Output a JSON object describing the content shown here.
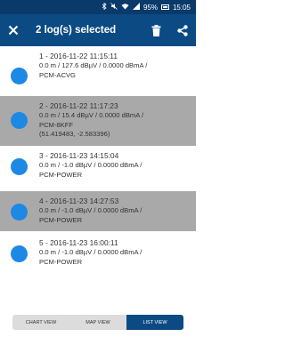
{
  "status_bar": {
    "bluetooth_icon": "bluetooth-icon",
    "mute_icon": "mute-icon",
    "wifi_icon": "wifi-icon",
    "signal_icon": "signal-icon",
    "battery_percent": "95%",
    "time": "15:05"
  },
  "app_bar": {
    "title": "2 log(s) selected",
    "close_icon": "close-icon",
    "delete_icon": "trash-icon",
    "share_icon": "share-icon"
  },
  "logs": [
    {
      "heading": "1 - 2016-11-22 11:15:11",
      "lines": [
        "0.0 m / 127.6 dBµV / 0.0000 dBmA /",
        "PCM-ACVG"
      ],
      "selected": false
    },
    {
      "heading": "2 - 2016-11-22 11:17:23",
      "lines": [
        "0.0 m / 15.4 dBµV / 0.0000 dBmA /",
        "PCM-8KFF",
        "(51.419483, -2.583396)"
      ],
      "selected": true
    },
    {
      "heading": "3 - 2016-11-23 14:15:04",
      "lines": [
        "0.0 m / -1.0 dBµV / 0.0000 dBmA /",
        "PCM-POWER"
      ],
      "selected": false
    },
    {
      "heading": "4 - 2016-11-23 14:27:53",
      "lines": [
        "0.0 m / -1.0 dBµV / 0.0000 dBmA /",
        "PCM-POWER"
      ],
      "selected": true
    },
    {
      "heading": "5 - 2016-11-23 16:00:11",
      "lines": [
        "0.0 m / -1.0 dBµV / 0.0000 dBmA /",
        "PCM-POWER"
      ],
      "selected": false
    }
  ],
  "tabs": [
    {
      "label": "CHART VIEW",
      "active": false
    },
    {
      "label": "MAP VIEW",
      "active": false
    },
    {
      "label": "LIST VIEW",
      "active": true
    }
  ],
  "colors": {
    "app_bar": "#0c4a84",
    "status_bar": "#0a3a6a",
    "selected_row": "#a9a9a9",
    "dot": "#1e88e5"
  }
}
